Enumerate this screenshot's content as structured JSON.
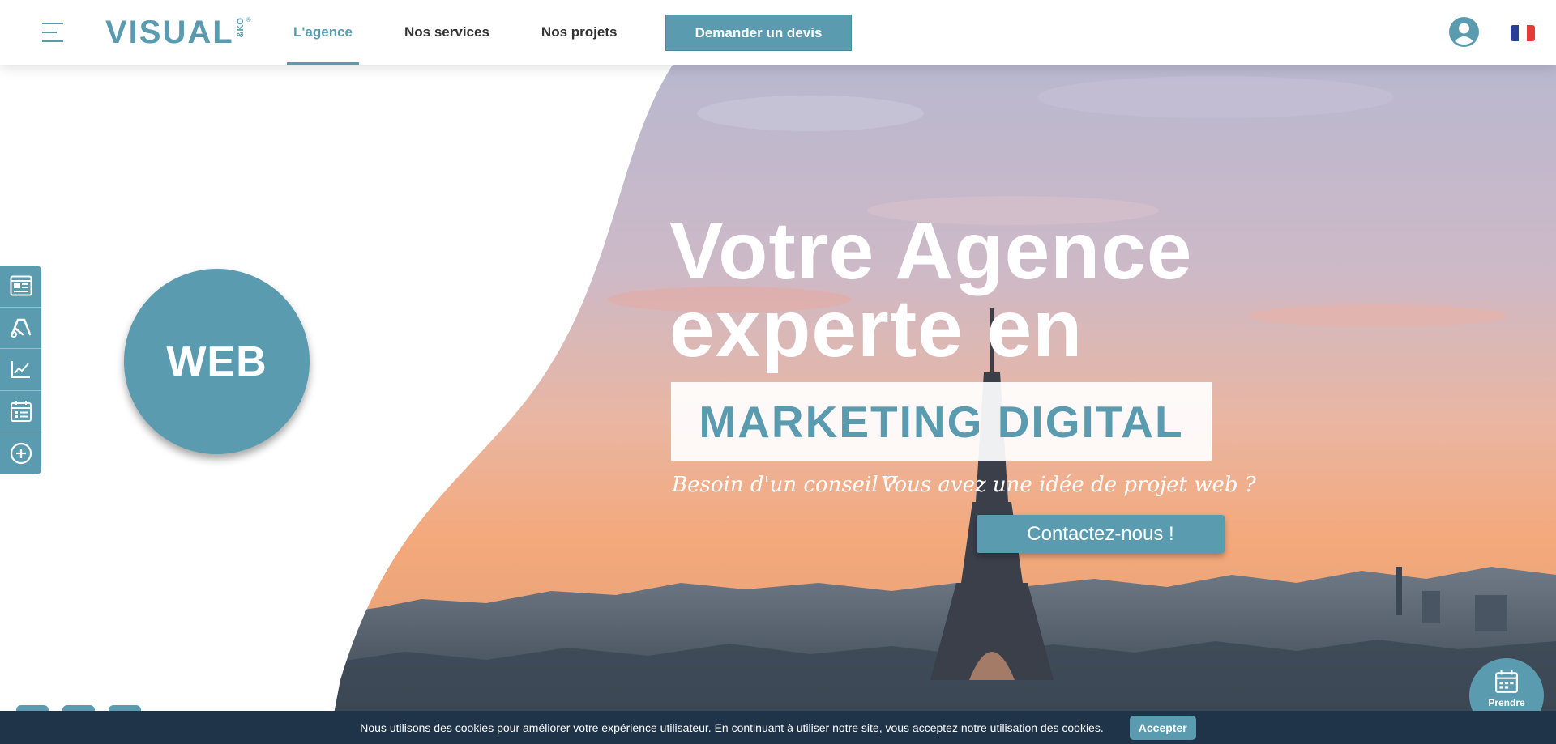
{
  "brand": {
    "logo_text": "VISUAL",
    "logo_sub": "&KO",
    "logo_reg": "®",
    "accent_color": "#5a9bb0"
  },
  "header": {
    "nav": [
      {
        "label": "L'agence",
        "active": true
      },
      {
        "label": "Nos services",
        "active": false
      },
      {
        "label": "Nos projets",
        "active": false
      }
    ],
    "cta_label": "Demander un devis",
    "user_icon": "user-circle-icon",
    "language_flag": "flag-fr-icon"
  },
  "side_tools": [
    {
      "icon": "browser-window-icon"
    },
    {
      "icon": "google-ads-icon"
    },
    {
      "icon": "line-chart-icon"
    },
    {
      "icon": "calendar-icon"
    },
    {
      "icon": "plus-circle-icon"
    }
  ],
  "hero": {
    "rotating_word": "WEB",
    "title_line1": "Votre Agence",
    "title_line2": "experte en",
    "highlight": "MARKETING DIGITAL",
    "question1": "Besoin d'un conseil ?",
    "question2": "Vous avez une idée de projet web ?",
    "contact_label": "Contactez-nous !"
  },
  "social": [
    {
      "icon": "facebook-icon"
    },
    {
      "icon": "instagram-icon"
    },
    {
      "icon": "linkedin-icon"
    }
  ],
  "appointment": {
    "label": "Prendre",
    "icon": "calendar-icon"
  },
  "cookie_bar": {
    "text": "Nous utilisons des cookies pour améliorer votre expérience utilisateur. En continuant à utiliser notre site, vous acceptez notre utilisation des cookies.",
    "accept_label": "Accepter"
  }
}
